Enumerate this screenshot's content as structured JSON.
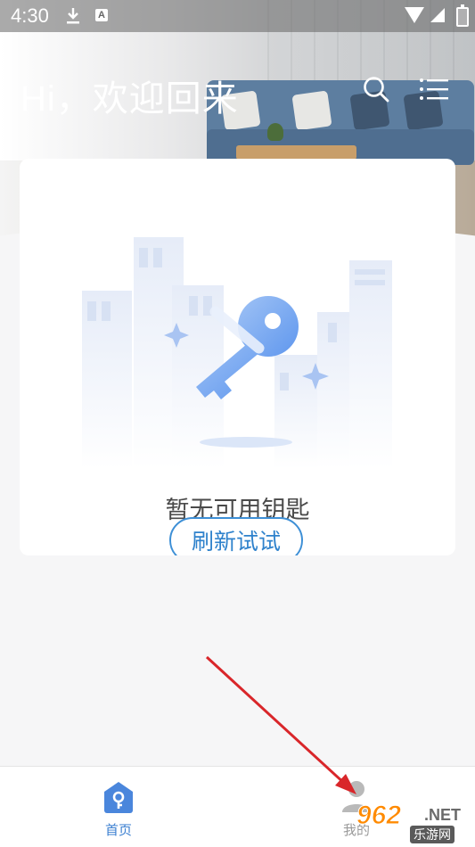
{
  "status_bar": {
    "time": "4:30",
    "icons": [
      "download-icon",
      "a-notification-icon",
      "wifi-icon",
      "signal-icon",
      "battery-icon"
    ]
  },
  "header": {
    "greeting": "Hi，欢迎回来",
    "icons": [
      "search-icon",
      "menu-icon"
    ]
  },
  "empty_state": {
    "message": "暂无可用钥匙",
    "refresh_label": "刷新试试",
    "illustration": "key-building-illustration"
  },
  "bottom_nav": {
    "items": [
      {
        "label": "首页",
        "icon": "home-key-icon",
        "active": true
      },
      {
        "label": "我的",
        "icon": "user-icon",
        "active": false
      }
    ]
  },
  "watermark": {
    "brand_number": "962",
    "brand_suffix": ".NET",
    "brand_cn": "乐游网"
  },
  "colors": {
    "accent": "#3b7fd0",
    "arrow": "#d9262a",
    "background": "#f6f6f7"
  }
}
